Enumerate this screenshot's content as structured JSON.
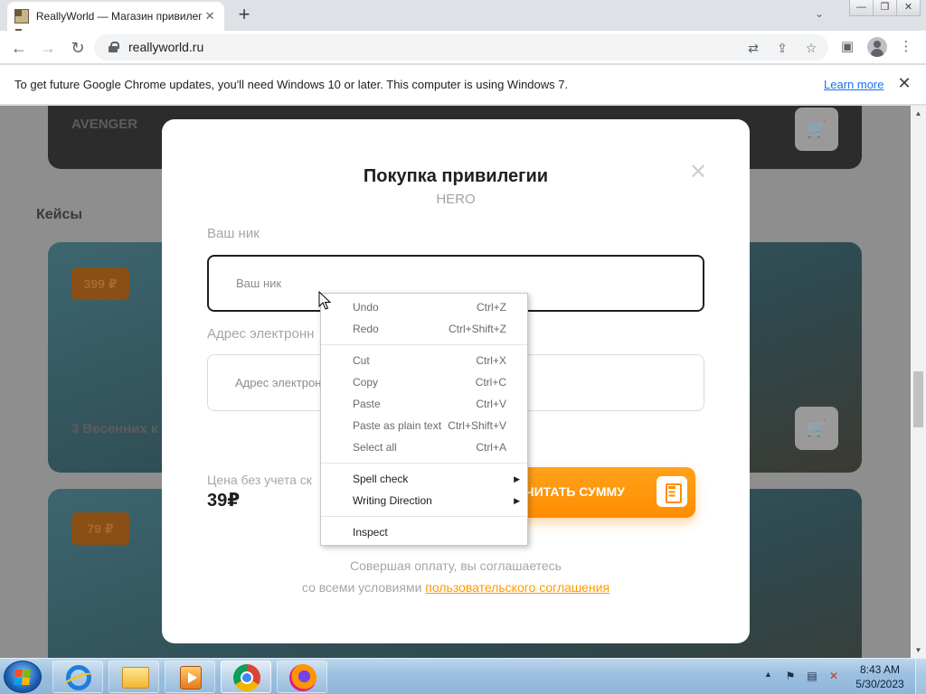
{
  "browser": {
    "tab_title": "ReallyWorld — Магазин привилегий",
    "tab_close": "✕",
    "new_tab": "+",
    "url": "reallyworld.ru",
    "window_buttons": [
      "—",
      "❐",
      "✕"
    ]
  },
  "infobar": {
    "message": "To get future Google Chrome updates, you'll need Windows 10 or later. This computer is using Windows 7.",
    "link": "Learn more",
    "close": "✕"
  },
  "page": {
    "top_card_title": "AVENGER",
    "section_title": "Кейсы",
    "case_card_1": {
      "price": "399 ₽",
      "title": "3 Весенних к"
    },
    "case_card_2": {
      "price": "79 ₽"
    },
    "cart_icon": "🛒"
  },
  "modal": {
    "title": "Покупка привилегии",
    "subtitle": "HERO",
    "close": "✕",
    "nick_label": "Ваш ник",
    "nick_placeholder": "Ваш ник",
    "email_label": "Адрес электронн",
    "email_placeholder": "Адрес электрон",
    "price_label": "Цена без учета ск",
    "price_value": "39₽",
    "calc_button": "СЧИТАТЬ СУММУ",
    "agree_line1": "Совершая оплату, вы соглашаетесь",
    "agree_line2_prefix": "со всеми условиями ",
    "agree_link": "пользовательского соглашения"
  },
  "context_menu": {
    "items": [
      {
        "label": "Undo",
        "shortcut": "Ctrl+Z"
      },
      {
        "label": "Redo",
        "shortcut": "Ctrl+Shift+Z"
      },
      {
        "label": "Cut",
        "shortcut": "Ctrl+X"
      },
      {
        "label": "Copy",
        "shortcut": "Ctrl+C"
      },
      {
        "label": "Paste",
        "shortcut": "Ctrl+V"
      },
      {
        "label": "Paste as plain text",
        "shortcut": "Ctrl+Shift+V"
      },
      {
        "label": "Select all",
        "shortcut": "Ctrl+A"
      },
      {
        "label": "Spell check",
        "shortcut": ""
      },
      {
        "label": "Writing Direction",
        "shortcut": ""
      },
      {
        "label": "Inspect",
        "shortcut": ""
      }
    ],
    "submenu_arrow": "▶"
  },
  "taskbar": {
    "time": "8:43 AM",
    "date": "5/30/2023",
    "tray_arrow": "▲"
  },
  "colors": {
    "accent_orange": "#ff9800",
    "link_blue": "#1a73e8",
    "overlay_gray": "#8e8e8e"
  }
}
